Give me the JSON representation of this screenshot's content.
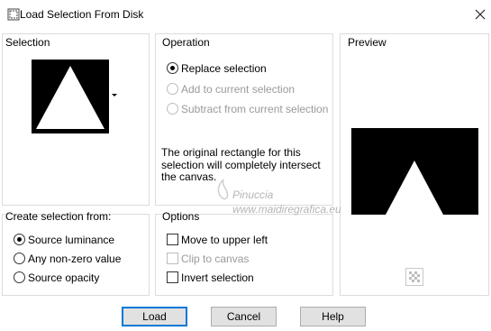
{
  "window": {
    "title": "Load Selection From Disk"
  },
  "selection": {
    "label": "Selection"
  },
  "operation": {
    "label": "Operation",
    "options": [
      {
        "label": "Replace selection",
        "selected": true,
        "enabled": true
      },
      {
        "label": "Add to current selection",
        "selected": false,
        "enabled": false
      },
      {
        "label": "Subtract from current selection",
        "selected": false,
        "enabled": false
      }
    ],
    "info": "The original rectangle for this selection will completely intersect the canvas."
  },
  "preview": {
    "label": "Preview"
  },
  "create": {
    "label": "Create selection from:",
    "options": [
      {
        "label": "Source luminance",
        "selected": true
      },
      {
        "label": "Any non-zero value",
        "selected": false
      },
      {
        "label": "Source opacity",
        "selected": false
      }
    ]
  },
  "options": {
    "label": "Options",
    "items": [
      {
        "label": "Move to upper left",
        "checked": false,
        "enabled": true
      },
      {
        "label": "Clip to canvas",
        "checked": false,
        "enabled": false
      },
      {
        "label": "Invert selection",
        "checked": false,
        "enabled": true
      }
    ]
  },
  "buttons": {
    "load": "Load",
    "cancel": "Cancel",
    "help": "Help"
  },
  "watermark": {
    "line1": "Pinuccia",
    "line2": "www.maidiregrafica.eu"
  }
}
